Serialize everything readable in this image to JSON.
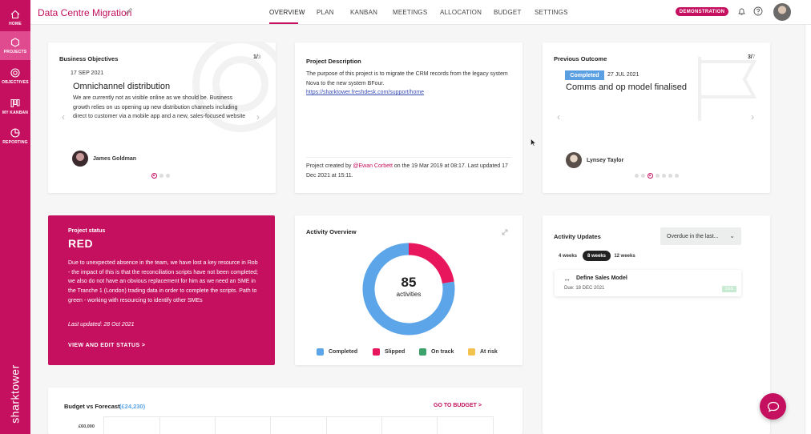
{
  "nav": {
    "items": [
      {
        "label": "HOME",
        "icon": "home-icon"
      },
      {
        "label": "PROJECTS",
        "icon": "projects-icon"
      },
      {
        "label": "OBJECTIVES",
        "icon": "objectives-icon"
      },
      {
        "label": "MY KANBAN",
        "icon": "kanban-icon"
      },
      {
        "label": "REPORTING",
        "icon": "reporting-icon"
      }
    ],
    "active": "PROJECTS",
    "brand": "sharktower"
  },
  "header": {
    "project_title": "Data Centre Migration",
    "tabs": [
      "OVERVIEW",
      "PLAN",
      "KANBAN",
      "MEETINGS",
      "ALLOCATION",
      "BUDGET",
      "SETTINGS"
    ],
    "active_tab": "OVERVIEW",
    "badge": "DEMONSTRATION"
  },
  "objectives": {
    "title": "Business Objectives",
    "current": "1",
    "total": "3",
    "date": "17 SEP 2021",
    "item_title": "Omnichannel distribution",
    "text": "We are currently not as visible online as we should be. Business growth relies on us opening up new distribution channels including direct to customer via a mobile app and a new, sales-focused website",
    "person": "James Goldman"
  },
  "description": {
    "title": "Project Description",
    "text": "The purpose of this project is to migrate the CRM records from the legacy system Nova to the new system BFour.",
    "link": "https://sharktower.freshdesk.com/support/home",
    "created_prefix": "Project created by",
    "created_by": "@Ewan Corbett",
    "created_suffix": "on the 19 Mar 2019 at 08:17. Last updated 17 Dec 2021 at 15:11."
  },
  "outcome": {
    "title": "Previous Outcome",
    "current": "3",
    "total": "7",
    "status": "Completed",
    "date": "27 JUL 2021",
    "item_title": "Comms and op model finalised",
    "person": "Lynsey Taylor"
  },
  "status": {
    "label": "Project status",
    "value": "RED",
    "text": "Due to unexpected absence in the team, we have lost a key resource in Rob - the impact of this is that the reconciliation scripts have not been completed; we also do not have an obvious replacement for him as we need an SME in the Tranche 1 (London) trading data in order to complete the scripts. Path to green - working with resourcing to identify other SMEs",
    "updated": "Last updated: 28 Oct 2021",
    "cta": "VIEW AND EDIT STATUS >"
  },
  "activity": {
    "title": "Activity Overview",
    "total": "85",
    "unit": "activities",
    "legend": [
      {
        "label": "Completed",
        "color": "#5ba5e8"
      },
      {
        "label": "Slipped",
        "color": "#e8175d"
      },
      {
        "label": "On track",
        "color": "#3aa26a"
      },
      {
        "label": "At risk",
        "color": "#f2c14e"
      }
    ]
  },
  "chart_data": {
    "type": "pie",
    "categories": [
      "Completed",
      "Slipped",
      "On track",
      "At risk"
    ],
    "values": [
      66,
      19,
      0,
      0
    ],
    "title": "Activity Overview"
  },
  "updates": {
    "title": "Activity Updates",
    "filter": "Overdue in the last...",
    "periods": [
      "4 weeks",
      "8 weeks",
      "12 weeks"
    ],
    "active_period": "8 weeks",
    "item": {
      "title": "Define Sales Model",
      "due": "Due: 18 DEC 2021",
      "badge": "DES"
    }
  },
  "budget": {
    "title": "Budget vs Forecast",
    "amount": "(£24,230)",
    "cta": "GO TO BUDGET >",
    "first_tick": "£60,000"
  }
}
